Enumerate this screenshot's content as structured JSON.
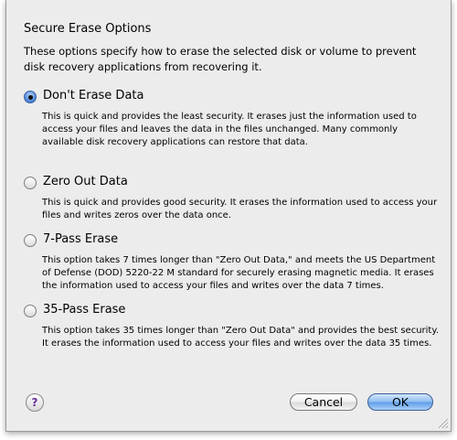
{
  "dialog": {
    "title": "Secure Erase Options",
    "intro": "These options specify how to erase the selected disk or volume to prevent disk recovery applications from recovering it."
  },
  "options": [
    {
      "label": "Don't Erase Data",
      "description": "This is quick and provides the least security. It erases just the information used to access your files and leaves the data in the files unchanged. Many commonly available disk recovery applications can restore that data.",
      "selected": true
    },
    {
      "label": "Zero Out Data",
      "description": "This is quick and provides good security. It erases the information used to access your files and writes zeros over the data once.",
      "selected": false
    },
    {
      "label": "7-Pass Erase",
      "description": "This option takes 7 times longer than \"Zero Out Data,\" and meets the US Department of Defense (DOD) 5220-22 M standard for securely erasing magnetic media. It erases the information used to access your files and writes over the data 7 times.",
      "selected": false
    },
    {
      "label": "35-Pass Erase",
      "description": "This option takes 35 times longer than \"Zero Out Data\" and provides the best security. It erases the information used to access your files and writes over the data 35 times.",
      "selected": false
    }
  ],
  "buttons": {
    "help": "?",
    "cancel": "Cancel",
    "ok": "OK"
  },
  "colors": {
    "dialog_bg": "#ececec",
    "default_button": "#6fa8ec",
    "help_glyph": "#6b2d9a"
  }
}
